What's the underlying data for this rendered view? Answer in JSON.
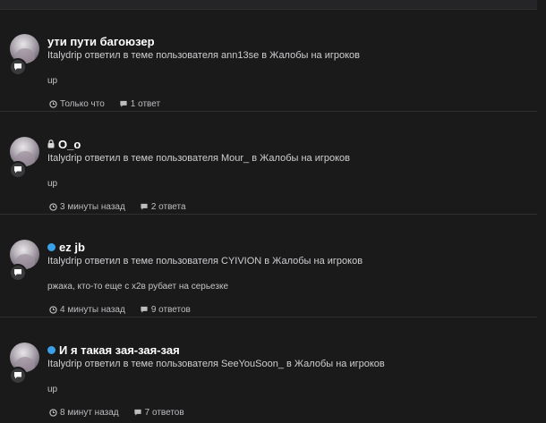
{
  "feed": {
    "items": [
      {
        "title": "ути пути багоюзер",
        "prefix_icon": "none",
        "description": "Italydrip ответил в теме пользователя ann13se в Жалобы на игроков",
        "snippet": "up",
        "time": "Только что",
        "replies": "1 ответ"
      },
      {
        "title": "O_o",
        "prefix_icon": "lock-icon",
        "description": "Italydrip ответил в теме пользователя Mour_ в Жалобы на игроков",
        "snippet": "up",
        "time": "3 минуты назад",
        "replies": "2 ответа"
      },
      {
        "title": "ez jb",
        "prefix_icon": "status-dot-icon",
        "description": "Italydrip ответил в теме пользователя CYIVION в Жалобы на игроков",
        "snippet": "ржака, кто-то еще с х2в рубает на серьезке",
        "time": "4 минуты назад",
        "replies": "9 ответов"
      },
      {
        "title": "И я такая зая-зая-зая",
        "prefix_icon": "status-dot-icon",
        "description": "Italydrip ответил в теме пользователя SeeYouSoon_ в Жалобы на игроков",
        "snippet": "up",
        "time": "8 минут назад",
        "replies": "7 ответов"
      }
    ]
  },
  "colors": {
    "background": "#1a1a1b",
    "title": "#ffffff",
    "text": "#cfcfd2",
    "status_dot": "#3aa0e8",
    "divider": "#2f2f32"
  }
}
